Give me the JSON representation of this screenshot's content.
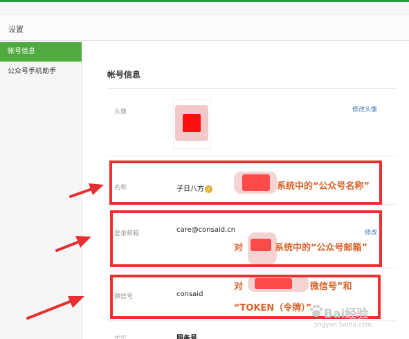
{
  "header": {
    "title": "设置"
  },
  "sidebar": {
    "items": [
      {
        "label": "帐号信息",
        "active": true
      },
      {
        "label": "公众号手机助手",
        "active": false
      }
    ]
  },
  "main": {
    "section_title": "帐号信息",
    "rows": {
      "avatar": {
        "label": "头像",
        "action": "修改头像"
      },
      "name": {
        "label": "名称",
        "value": "子日八方"
      },
      "email": {
        "label": "登录邮箱",
        "value": "care@consaid.cn",
        "action": "修改"
      },
      "wechat_id": {
        "label": "微信号",
        "value": "consaid"
      },
      "type": {
        "label": "类型",
        "value": "服务号"
      }
    }
  },
  "annotations": {
    "name_note": "系统中的“公众号名称”",
    "email_note_prefix": "对",
    "email_note_suffix": "系统中的“公众号邮箱”",
    "wechat_note_line1_prefix": "对",
    "wechat_note_line1_suffix": "微信号”和",
    "wechat_note_line2": "“TOKEN（令牌）”"
  },
  "watermark": {
    "brand": "Bai经验",
    "url": "jingyan.baidu.com"
  },
  "colors": {
    "accent_green": "#4faa3f",
    "highlight_red": "#ee2f2f",
    "annotation_orange": "#d9622a",
    "link_blue": "#3e75b4"
  },
  "icons": {
    "verified": "check-badge-icon",
    "watermark": "paw-icon"
  }
}
